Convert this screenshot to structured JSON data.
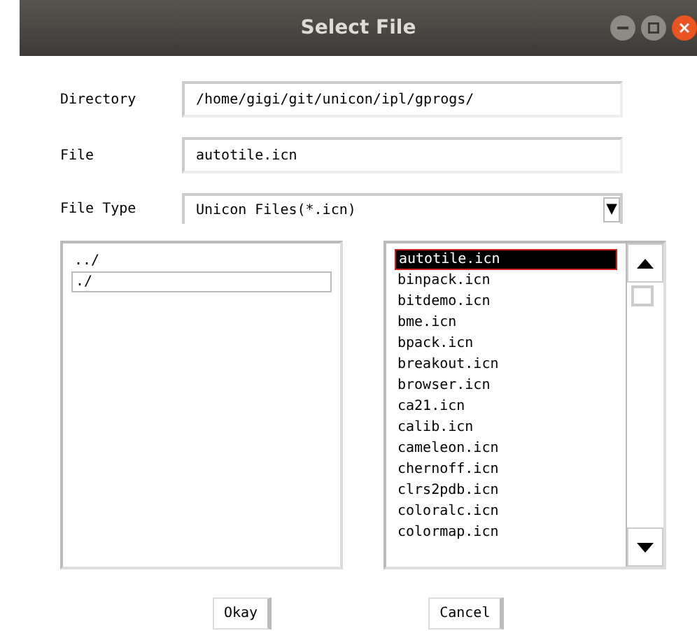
{
  "window": {
    "title": "Select File"
  },
  "fields": [
    {
      "label": "Directory",
      "value": "/home/gigi/git/unicon/ipl/gprogs/"
    },
    {
      "label": "File",
      "value": "autotile.icn"
    }
  ],
  "file_type": {
    "label": "File Type",
    "value": "Unicon Files(*.icn)",
    "arrow": "▼"
  },
  "directories": [
    {
      "name": "../",
      "selected": false
    },
    {
      "name": "./",
      "selected": true
    }
  ],
  "files": [
    {
      "name": "autotile.icn",
      "selected": true
    },
    {
      "name": "binpack.icn",
      "selected": false
    },
    {
      "name": "bitdemo.icn",
      "selected": false
    },
    {
      "name": "bme.icn",
      "selected": false
    },
    {
      "name": "bpack.icn",
      "selected": false
    },
    {
      "name": "breakout.icn",
      "selected": false
    },
    {
      "name": "browser.icn",
      "selected": false
    },
    {
      "name": "ca21.icn",
      "selected": false
    },
    {
      "name": "calib.icn",
      "selected": false
    },
    {
      "name": "cameleon.icn",
      "selected": false
    },
    {
      "name": "chernoff.icn",
      "selected": false
    },
    {
      "name": "clrs2pdb.icn",
      "selected": false
    },
    {
      "name": "coloralc.icn",
      "selected": false
    },
    {
      "name": "colormap.icn",
      "selected": false
    }
  ],
  "buttons": [
    "Okay",
    "Cancel"
  ]
}
